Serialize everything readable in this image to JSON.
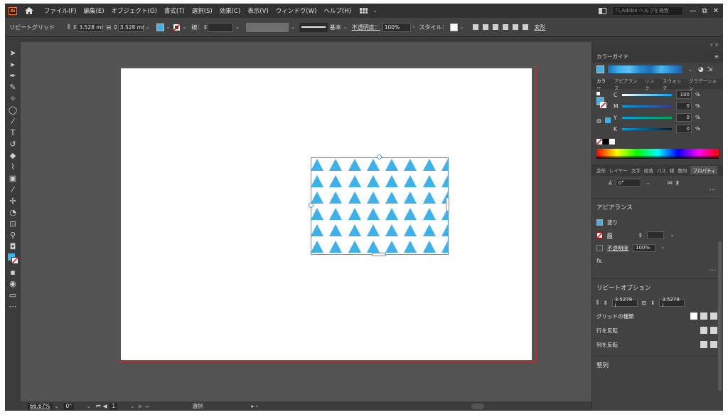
{
  "app": {
    "logo": "Ai",
    "menus": [
      "ファイル(F)",
      "編集(E)",
      "オブジェクト(O)",
      "書式(T)",
      "選択(S)",
      "効果(C)",
      "表示(V)",
      "ウィンドウ(W)",
      "ヘルプ(H)"
    ],
    "search_placeholder": "Adobe ヘルプを検索",
    "window_controls": {
      "minimize": "—",
      "restore": "⧉",
      "close": "✕"
    }
  },
  "control_bar": {
    "mode_label": "リピートグリッド",
    "h_spacing": "3.528 mr",
    "v_spacing": "3.528 mr",
    "stroke_label": "線：",
    "stroke_style": "基本",
    "opacity_label": "不透明度：",
    "opacity_value": "100%",
    "style_label": "スタイル：",
    "transform_label": "変形",
    "colors": {
      "fill": "#3db2ea"
    }
  },
  "status_bar": {
    "zoom": "66.67%",
    "rotation": "0°",
    "page": "1",
    "tool_label": "選択"
  },
  "panels": {
    "color_guide": {
      "title": "カラーガイド"
    },
    "color_tabs": [
      "カラー",
      "アピアランス",
      "リンク",
      "スウォッチ",
      "グラデーション"
    ],
    "cmyk": [
      {
        "letter": "C",
        "value": "100",
        "unit": "%"
      },
      {
        "letter": "M",
        "value": "0",
        "unit": "%"
      },
      {
        "letter": "Y",
        "value": "0",
        "unit": "%"
      },
      {
        "letter": "K",
        "value": "0",
        "unit": "%"
      }
    ],
    "props_tabs": [
      "変形",
      "レイヤー",
      "文字",
      "段落",
      "パス",
      "線",
      "整列",
      "プロパティ"
    ],
    "angle_value": "0°",
    "appearance": {
      "title": "アピアランス",
      "fill_label": "塗り",
      "stroke_label": "線",
      "opacity_label": "不透明度",
      "opacity_value": "100%",
      "fx_label": "fx."
    },
    "repeat_options": {
      "title": "リピートオプション",
      "h_spacing": "3.5278 i",
      "v_spacing": "3.5278 i",
      "grid_type_label": "グリッドの種類",
      "flip_row_label": "行を反転",
      "flip_col_label": "列を反転"
    },
    "align_title": "整列"
  }
}
